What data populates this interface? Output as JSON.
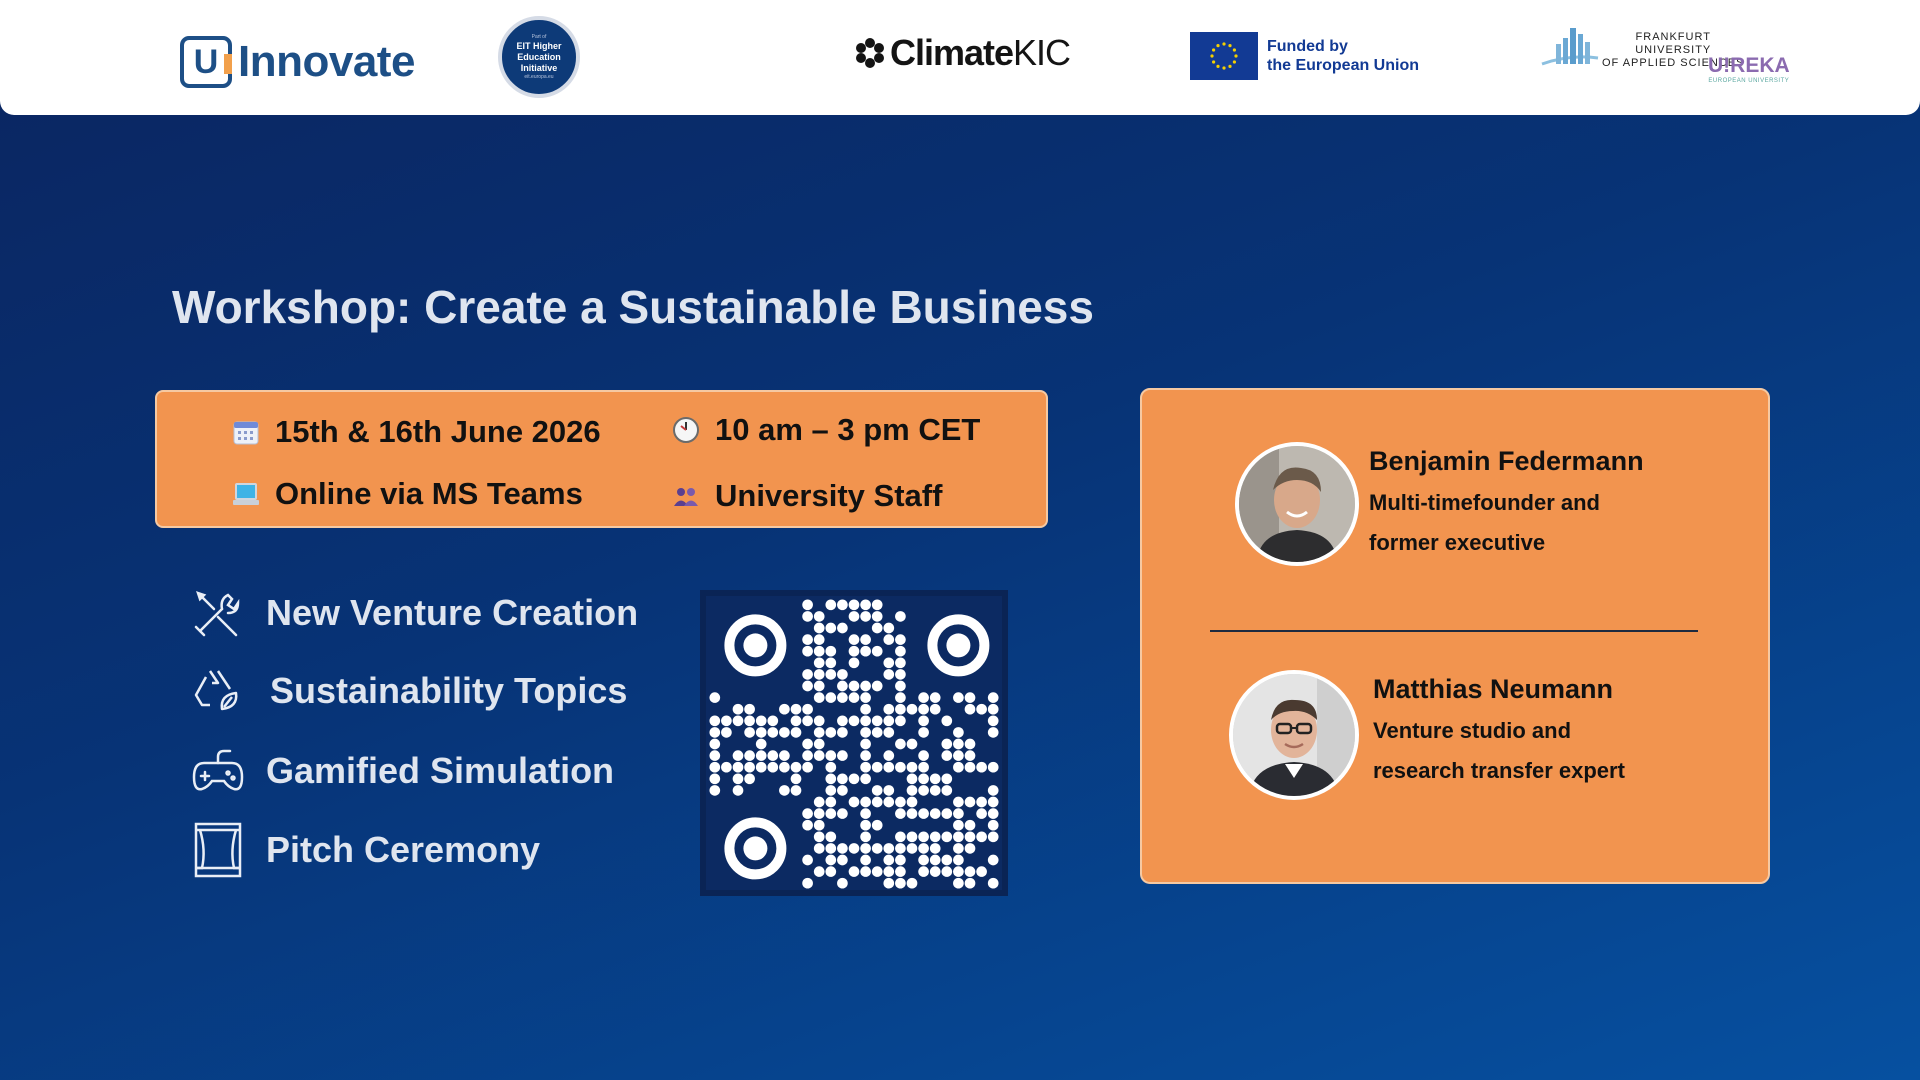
{
  "header": {
    "innovate": {
      "letter": "U",
      "text": "Innovate"
    },
    "eit": {
      "top": "Part of",
      "line1": "EIT Higher",
      "line2": "Education",
      "line3": "Initiative",
      "bottom": "eit.europa.eu"
    },
    "climate": {
      "part1": "Climate",
      "part2": "KIC"
    },
    "eu": {
      "line1": "Funded by",
      "line2": "the European Union"
    },
    "frankfurt": {
      "line1": "FRANKFURT",
      "line2": "UNIVERSITY",
      "line3": "OF APPLIED SCIENCES"
    },
    "ureka": {
      "main": "U!REKA",
      "sub": "EUROPEAN UNIVERSITY"
    }
  },
  "title": "Workshop: Create a Sustainable Business",
  "info": {
    "date": "15th & 16th June 2026",
    "time": "10 am – 3 pm CET",
    "location": "Online via MS Teams",
    "audience": "University Staff"
  },
  "topics": [
    {
      "label": "New Venture Creation",
      "icon": "tools-icon"
    },
    {
      "label": "Sustainability Topics",
      "icon": "recycle-leaf-icon"
    },
    {
      "label": "Gamified Simulation",
      "icon": "gamepad-icon"
    },
    {
      "label": "Pitch Ceremony",
      "icon": "stage-curtain-icon"
    }
  ],
  "speakers": [
    {
      "name": "Benjamin Federmann",
      "role_line1": "Multi-timefounder and",
      "role_line2": "former executive"
    },
    {
      "name": "Matthias Neumann",
      "role_line1": "Venture studio and",
      "role_line2": "research transfer expert"
    }
  ],
  "colors": {
    "accent": "#f2944f",
    "brand": "#1d4f86",
    "title": "#dfe5ef"
  }
}
